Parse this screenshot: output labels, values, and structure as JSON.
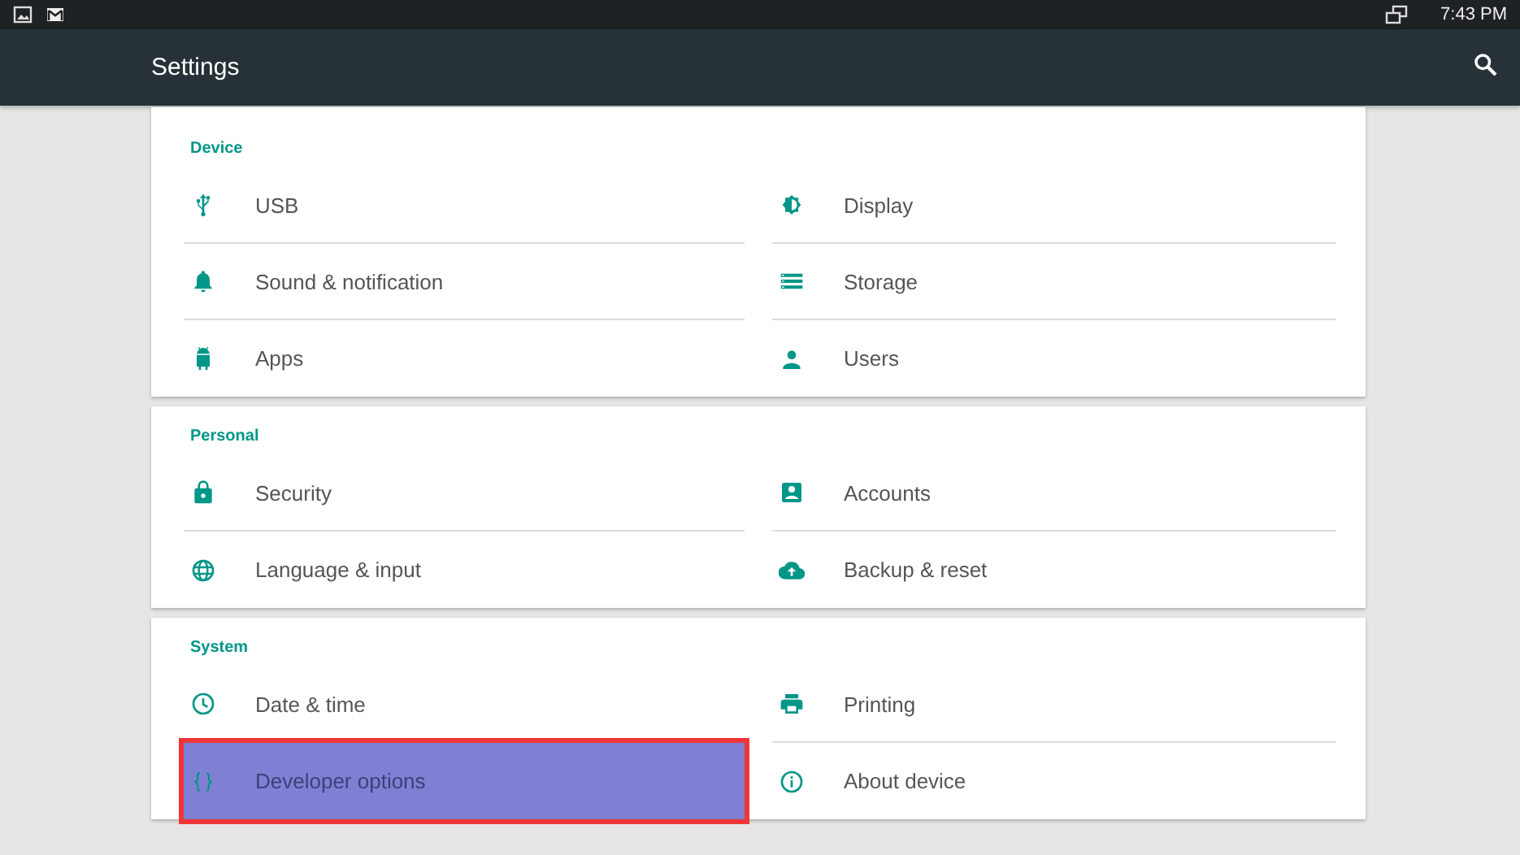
{
  "status_bar": {
    "time": "7:43 PM"
  },
  "toolbar": {
    "title": "Settings"
  },
  "sections": [
    {
      "title": "Device",
      "items": [
        {
          "label": "USB",
          "selected": false
        },
        {
          "label": "Display",
          "selected": false
        },
        {
          "label": "Sound & notification",
          "selected": false
        },
        {
          "label": "Storage",
          "selected": false
        },
        {
          "label": "Apps",
          "selected": false
        },
        {
          "label": "Users",
          "selected": false
        }
      ]
    },
    {
      "title": "Personal",
      "items": [
        {
          "label": "Security",
          "selected": false
        },
        {
          "label": "Accounts",
          "selected": false
        },
        {
          "label": "Language & input",
          "selected": false
        },
        {
          "label": "Backup & reset",
          "selected": false
        }
      ]
    },
    {
      "title": "System",
      "items": [
        {
          "label": "Date & time",
          "selected": false
        },
        {
          "label": "Printing",
          "selected": false
        },
        {
          "label": "Developer options",
          "selected": true
        },
        {
          "label": "About device",
          "selected": false
        }
      ]
    }
  ]
}
